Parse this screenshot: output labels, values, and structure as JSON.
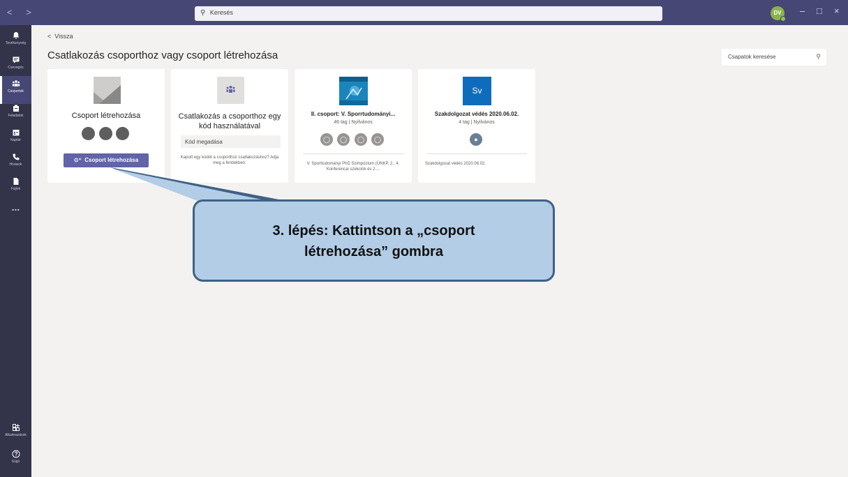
{
  "topbar": {
    "search_placeholder": "Keresés",
    "user_initials": "DV",
    "nav_arrows": "< >",
    "minimize": "–",
    "maximize": "□",
    "close": "×"
  },
  "rail": {
    "items": [
      {
        "label": "Tevékenység",
        "icon": "bell-icon"
      },
      {
        "label": "Csevegés",
        "icon": "chat-icon"
      },
      {
        "label": "Csoportok",
        "icon": "teams-icon",
        "active": true
      },
      {
        "label": "Feladatok",
        "icon": "assignments-icon"
      },
      {
        "label": "Naptár",
        "icon": "calendar-icon"
      },
      {
        "label": "Hívások",
        "icon": "phone-icon"
      },
      {
        "label": "Fájlok",
        "icon": "file-icon"
      }
    ],
    "more": "...",
    "apps_label": "Alkalmazások",
    "help_label": "Súgó"
  },
  "main": {
    "back_label": "Vissza",
    "title": "Csatlakozás csoporthoz vagy csoport létrehozása",
    "team_search_placeholder": "Csapatok keresése"
  },
  "cards": {
    "create": {
      "title": "Csoport létrehozása",
      "button_label": "Csoport létrehozása"
    },
    "join": {
      "title": "Csatlakozás a csoporthoz egy kód használatával",
      "input_placeholder": "Kód megadása",
      "hint": "Kapott egy kódot a csoporthoz csatlakozáshoz? Adja meg a fentiekben."
    },
    "team1": {
      "name": "II. csoport: V. Sporrtudományi...",
      "meta": "46 tag | Nyilvános",
      "description": "V. Sporttudományi PhD Szimpózium (ÚNKP, 2., 4. Konferencai szekciók és 2...."
    },
    "team2": {
      "avatar_text": "Sv",
      "name": "Szakdolgozat védés 2020.06.02.",
      "meta": "4 tag | Nyilvános",
      "description": "Szakdolgozat védés 2020.06.02."
    }
  },
  "callout": {
    "line1": "3. lépés: Kattintson a „csoport",
    "line2": "létrehozása” gombra"
  },
  "colors": {
    "topbar": "#464775",
    "rail": "#33344a",
    "accent": "#6264a7",
    "callout_fill": "#b3cde6",
    "callout_border": "#3f6184"
  }
}
